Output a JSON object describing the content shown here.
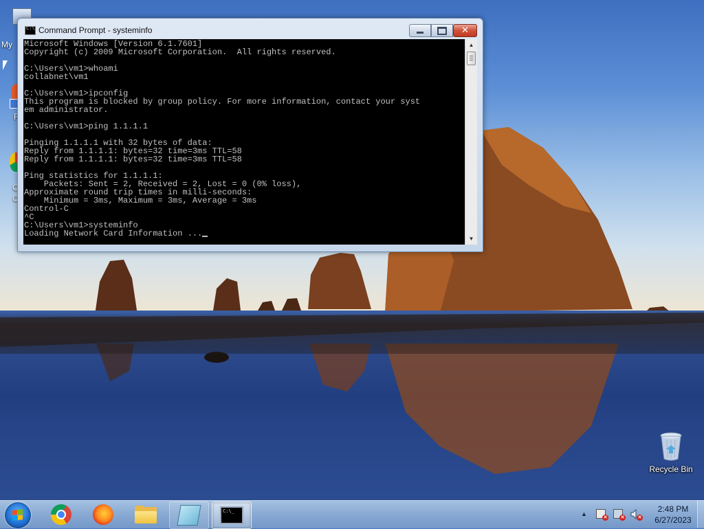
{
  "window": {
    "title": "Command Prompt - systeminfo",
    "console_lines": [
      "Microsoft Windows [Version 6.1.7601]",
      "Copyright (c) 2009 Microsoft Corporation.  All rights reserved.",
      "",
      "C:\\Users\\vm1>whoami",
      "collabnet\\vm1",
      "",
      "C:\\Users\\vm1>ipconfig",
      "This program is blocked by group policy. For more information, contact your syst",
      "em administrator.",
      "",
      "C:\\Users\\vm1>ping 1.1.1.1",
      "",
      "Pinging 1.1.1.1 with 32 bytes of data:",
      "Reply from 1.1.1.1: bytes=32 time=3ms TTL=58",
      "Reply from 1.1.1.1: bytes=32 time=3ms TTL=58",
      "",
      "Ping statistics for 1.1.1.1:",
      "    Packets: Sent = 2, Received = 2, Lost = 0 (0% loss),",
      "Approximate round trip times in milli-seconds:",
      "    Minimum = 3ms, Maximum = 3ms, Average = 3ms",
      "Control-C",
      "^C",
      "C:\\Users\\vm1>systeminfo",
      "Loading Network Card Information ..."
    ]
  },
  "desktop": {
    "recycle_bin_label": "Recycle Bin",
    "edge_label_1": "My",
    "edge_label_2": "F",
    "edge_label_3": "C",
    "edge_label_4": "C"
  },
  "taskbar": {
    "icons": [
      "windows-start-icon",
      "chrome-icon",
      "firefox-icon",
      "file-explorer-icon",
      "notepad-icon",
      "command-prompt-icon"
    ],
    "clock_time": "2:48 PM",
    "clock_date": "6/27/2023",
    "cmd_icon_text": "C:\\_"
  },
  "colors": {
    "console_bg": "#000000",
    "console_text": "#c0c0c0",
    "close_button": "#c13a22"
  }
}
